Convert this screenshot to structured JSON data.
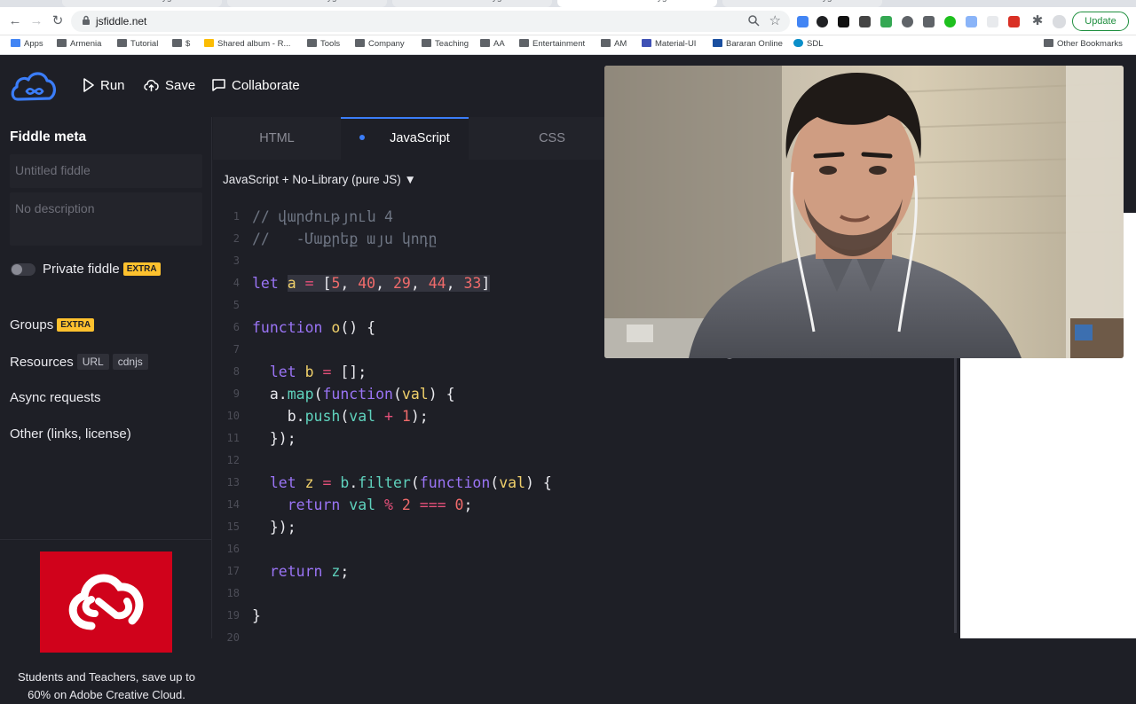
{
  "browser": {
    "tabs": [
      {
        "title": "JSFiddle - Code Playground",
        "active": false
      },
      {
        "title": "JSFiddle - Code Playground",
        "active": false
      },
      {
        "title": "JSFiddle - Code Playground",
        "active": false
      },
      {
        "title": "JSFiddle - Code Playground",
        "active": true
      },
      {
        "title": "JSFiddle - Code Playground",
        "active": false
      }
    ],
    "url": "jsfiddle.net",
    "update_label": "Update",
    "bookmarks": [
      "Apps",
      "Armenia",
      "Tutorial",
      "$",
      "Shared album - R...",
      "Tools",
      "Company",
      "Teaching",
      "AA",
      "Entertainment",
      "AM",
      "Material-UI",
      "Bararan Online",
      "SDL"
    ],
    "other_bookmarks": "Other Bookmarks"
  },
  "toolbar": {
    "run_label": "Run",
    "save_label": "Save",
    "collaborate_label": "Collaborate"
  },
  "sidebar": {
    "title": "Fiddle meta",
    "title_placeholder": "Untitled fiddle",
    "description_placeholder": "No description",
    "private_label": "Private fiddle",
    "extra_badge": "EXTRA",
    "groups_label": "Groups",
    "resources_label": "Resources",
    "resources_url_badge": "URL",
    "resources_cdnjs_badge": "cdnjs",
    "async_label": "Async requests",
    "other_label": "Other (links, license)",
    "ad_text": "Students and Teachers, save up to 60% on Adobe Creative Cloud."
  },
  "editor": {
    "tabs": [
      "HTML",
      "JavaScript",
      "CSS"
    ],
    "active_tab": "JavaScript",
    "language_label": "JavaScript + No-Library (pure JS)",
    "line_numbers": [
      "1",
      "2",
      "3",
      "4",
      "5",
      "6",
      "7",
      "8",
      "9",
      "10",
      "11",
      "12",
      "13",
      "14",
      "15",
      "16",
      "17",
      "18",
      "19",
      "20"
    ]
  },
  "colors": {
    "background": "#1e1f26",
    "accent_blue": "#3b7df8",
    "extra_badge": "#fdc12e",
    "ad_red": "#d0021b",
    "update_green": "#1e8e3e"
  },
  "icons": {
    "run": "play-icon",
    "save": "cloud-upload-icon",
    "collaborate": "chat-icon",
    "logo": "jsfiddle-cloud-logo",
    "ad": "creative-cloud-logo"
  }
}
